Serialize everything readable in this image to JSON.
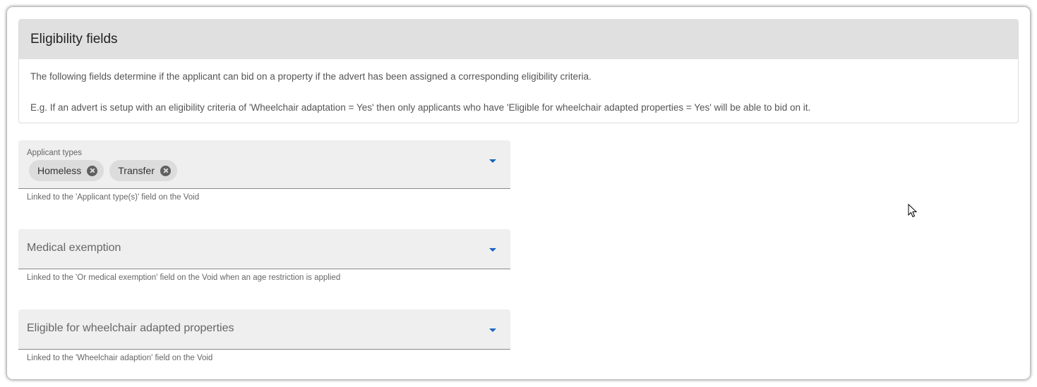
{
  "panel": {
    "title": "Eligibility fields",
    "description": "The following fields determine if the applicant can bid on a property if the advert has been assigned a corresponding eligibility criteria.",
    "example": "E.g. If an advert is setup with an eligibility criteria of 'Wheelchair adaptation = Yes' then only applicants who have 'Eligible for wheelchair adapted properties = Yes' will be able to bid on it."
  },
  "fields": {
    "applicant_types": {
      "label": "Applicant types",
      "chips": [
        "Homeless",
        "Transfer"
      ],
      "hint": "Linked to the 'Applicant type(s)' field on the Void",
      "icon": "chevron-down-icon"
    },
    "medical_exemption": {
      "placeholder": "Medical exemption",
      "hint": "Linked to the 'Or medical exemption' field on the Void when an age restriction is applied",
      "icon": "chevron-down-icon"
    },
    "wheelchair": {
      "placeholder": "Eligible for wheelchair adapted properties",
      "hint": "Linked to the 'Wheelchair adaption' field on the Void",
      "icon": "chevron-down-icon"
    }
  },
  "colors": {
    "accent": "#1565c0",
    "header_bg": "#e0e0e0",
    "field_bg": "#efefef",
    "chip_bg": "#dcdcdc"
  }
}
